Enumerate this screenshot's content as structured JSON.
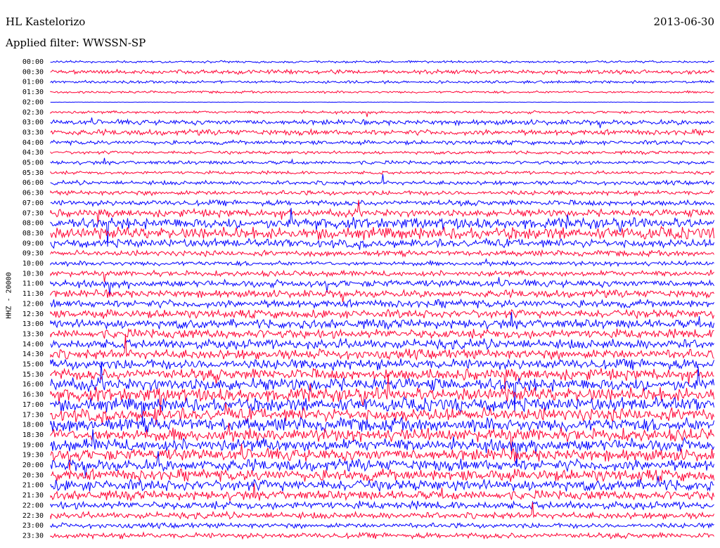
{
  "header": {
    "station": "HL Kastelorizo",
    "date": "2013-06-30",
    "filter": "Applied filter: WWSSN-SP"
  },
  "chart_data": {
    "type": "line",
    "title": "HL Kastelorizo",
    "ylabel": "HHZ - 20000",
    "colors": [
      "#0000ff",
      "#ff0033"
    ],
    "row_labels": [
      "00:00",
      "00:30",
      "01:00",
      "01:30",
      "02:00",
      "02:30",
      "03:00",
      "03:30",
      "04:00",
      "04:30",
      "05:00",
      "05:30",
      "06:00",
      "06:30",
      "07:00",
      "07:30",
      "08:00",
      "08:30",
      "09:00",
      "09:30",
      "10:00",
      "10:30",
      "11:00",
      "11:30",
      "12:00",
      "12:30",
      "13:00",
      "13:30",
      "14:00",
      "14:30",
      "15:00",
      "15:30",
      "16:00",
      "16:30",
      "17:00",
      "17:30",
      "18:00",
      "18:30",
      "19:00",
      "19:30",
      "20:00",
      "20:30",
      "21:00",
      "21:30",
      "22:00",
      "22:30",
      "23:00",
      "23:30"
    ],
    "row_noise_level": [
      0.25,
      0.45,
      0.3,
      0.25,
      0.05,
      0.3,
      0.55,
      0.6,
      0.45,
      0.35,
      0.4,
      0.35,
      0.45,
      0.5,
      0.6,
      0.8,
      1.2,
      1.3,
      0.9,
      0.6,
      0.5,
      0.6,
      0.75,
      0.8,
      0.85,
      0.9,
      1.0,
      1.0,
      1.05,
      1.05,
      1.1,
      1.2,
      1.4,
      1.5,
      1.45,
      1.4,
      1.45,
      1.4,
      1.35,
      1.3,
      1.25,
      1.25,
      1.2,
      1.0,
      0.85,
      0.7,
      0.55,
      0.6
    ]
  }
}
